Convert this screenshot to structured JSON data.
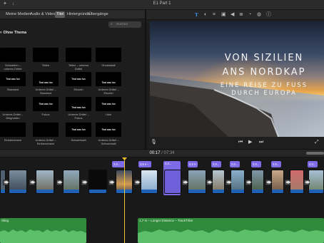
{
  "window": {
    "title": "E1 Part 1"
  },
  "browser": {
    "tabs": [
      "Meine Medien",
      "Audio & Video",
      "Titel",
      "Hintergründe",
      "Übergänge"
    ],
    "active_tab": "Titel",
    "search_placeholder": "Suchen",
    "section_title": "Ohne Thema",
    "tiles": [
      {
        "label": "Schweben – unteres Drittel",
        "thumb": ""
      },
      {
        "label": "Teilen",
        "thumb": ""
      },
      {
        "label": "Teilen – unteres Drittel",
        "thumb": ""
      },
      {
        "label": "Ohnekatalt",
        "thumb": ""
      },
      {
        "label": "Standard",
        "thumb": "That was fun"
      },
      {
        "label": "Unteres Drittel – Standard",
        "thumb": "That was fun"
      },
      {
        "label": "Einzeln",
        "thumb": "That was fun"
      },
      {
        "label": "Unteres Drittel – Einzeln",
        "thumb": "That was fun"
      },
      {
        "label": "Unteres Drittel – Weg/unten",
        "thumb": ""
      },
      {
        "label": "Fokus",
        "thumb": "That was fun"
      },
      {
        "label": "Unteres Drittel – Fokus",
        "thumb": "That was fun"
      },
      {
        "label": "Linie",
        "thumb": "That was fun"
      },
      {
        "label": "Einblendmeni",
        "thumb": ""
      },
      {
        "label": "Unteres Drittel – Einblendmeni",
        "thumb": ""
      },
      {
        "label": "Schwerkraft",
        "thumb": "That was fun"
      },
      {
        "label": "Unteres Drittel – Schwerkraft",
        "thumb": "That was fun"
      }
    ]
  },
  "viewer": {
    "title_line1": "VON SIZILIEN",
    "title_line2": "ANS NORDKAP",
    "subtitle_line1": "EINE REISE ZU FUSS",
    "subtitle_line2": "DURCH EUROPA"
  },
  "timeline": {
    "current_time": "00:17",
    "total_time": "07:34",
    "title_clips": [
      "2,0...",
      "3,5 s –",
      "2,0...",
      "3,5 s – T...",
      "2,0...",
      "2,0...",
      "2,0...",
      "2,0...",
      "2,0..."
    ],
    "audio_clips": [
      {
        "label": "Sling"
      },
      {
        "label": "1,7 m – Longer Distance – TrackTribe"
      }
    ],
    "transition_glyph": "◀▶"
  },
  "colors": {
    "accent": "#3d9bff",
    "title_clip": "#7c6ae6",
    "video_strip": "#1f62b5",
    "audio": "#2f8a3b",
    "playhead": "#f2c12e"
  },
  "icons": [
    "wand-icon",
    "back-icon",
    "forward-icon",
    "text-icon",
    "color-icon",
    "crop-icon",
    "camera-icon",
    "speaker-icon",
    "equalizer-icon",
    "speed-icon",
    "noise-icon",
    "info-icon",
    "mic-icon",
    "skip-back-icon",
    "play-icon",
    "skip-forward-icon",
    "fullscreen-icon"
  ]
}
